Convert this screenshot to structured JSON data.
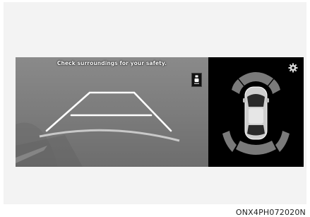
{
  "screen": {
    "caution_text": "Check surroundings for your safety.",
    "settings_icon": "gear-icon",
    "view_toggle_icon": "camera-view-icon"
  },
  "figure_code": "ONX4PH072020N",
  "colors": {
    "guide_line": "#ffffff",
    "sensor_zone": "#7a7a7a",
    "sensor_panel_bg": "#000000"
  }
}
